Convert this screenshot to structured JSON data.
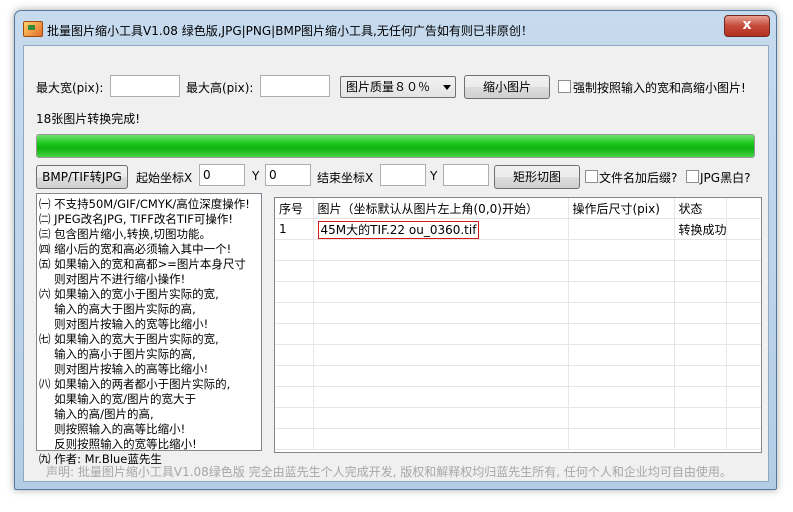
{
  "window": {
    "title": "批量图片缩小工具V1.08 绿色版,JPG|PNG|BMP图片缩小工具,无任何广告如有则已非原创！",
    "close_label": "x"
  },
  "top": {
    "max_width_label": "最大宽(pix):",
    "max_width_value": "",
    "max_height_label": "最大高(pix):",
    "max_height_value": "",
    "quality_selected": "图片质量８０％",
    "shrink_button": "缩小图片",
    "force_label": "强制按照输入的宽和高缩小图片!",
    "force_checked": false
  },
  "status": {
    "message": "18张图片转换完成!",
    "progress_percent": 100
  },
  "crop": {
    "convert_button": "BMP/TIF转JPG",
    "start_x_label": "起始坐标X",
    "start_x_value": "0",
    "start_y_label": "Y",
    "start_y_value": "0",
    "end_x_label": "结束坐标X",
    "end_x_value": "",
    "end_y_label": "Y",
    "end_y_value": "",
    "crop_button": "矩形切图",
    "suffix_label": "文件名加后缀?",
    "suffix_checked": false,
    "jpg_bw_label": "JPG黑白?",
    "jpg_bw_checked": false
  },
  "help_lines": [
    "㈠ 不支持50M/GIF/CMYK/高位深度操作!",
    "㈡ JPEG改名JPG, TIFF改名TIF可操作!",
    "㈢ 包含图片缩小,转换,切图功能。",
    "㈣ 缩小后的宽和高必须输入其中一个!",
    "㈤ 如果输入的宽和高都>=图片本身尺寸",
    "　 则对图片不进行缩小操作!",
    "㈥ 如果输入的宽小于图片实际的宽,",
    "　 输入的高大于图片实际的高,",
    "　 则对图片按输入的宽等比缩小!",
    "㈦ 如果输入的宽大于图片实际的宽,",
    "　 输入的高小于图片实际的高,",
    "　 则对图片按输入的高等比缩小!",
    "㈧ 如果输入的两者都小于图片实际的,",
    "　 如果输入的宽/图片的宽大于",
    "　 输入的高/图片的高,",
    "　 则按照输入的高等比缩小!",
    "　 反则按照输入的宽等比缩小!",
    "㈨ 作者: Mr.Blue蓝先生"
  ],
  "table": {
    "columns": [
      "序号",
      "图片（坐标默认从图片左上角(0,0)开始）",
      "操作后尺寸(pix)",
      "状态"
    ],
    "rows": [
      {
        "index": "1",
        "file": "45M大的TIF.22 ou_0360.tif",
        "size": "",
        "status": "转换成功"
      }
    ]
  },
  "footer": "声明: 批量图片缩小工具V1.08绿色版 完全由蓝先生个人完成开发, 版权和解释权均归蓝先生所有, 任何个人和企业均可自由使用。",
  "colors": {
    "progress": "#18c818",
    "highlight_border": "#d11a1a",
    "close_button": "#c4493a"
  }
}
